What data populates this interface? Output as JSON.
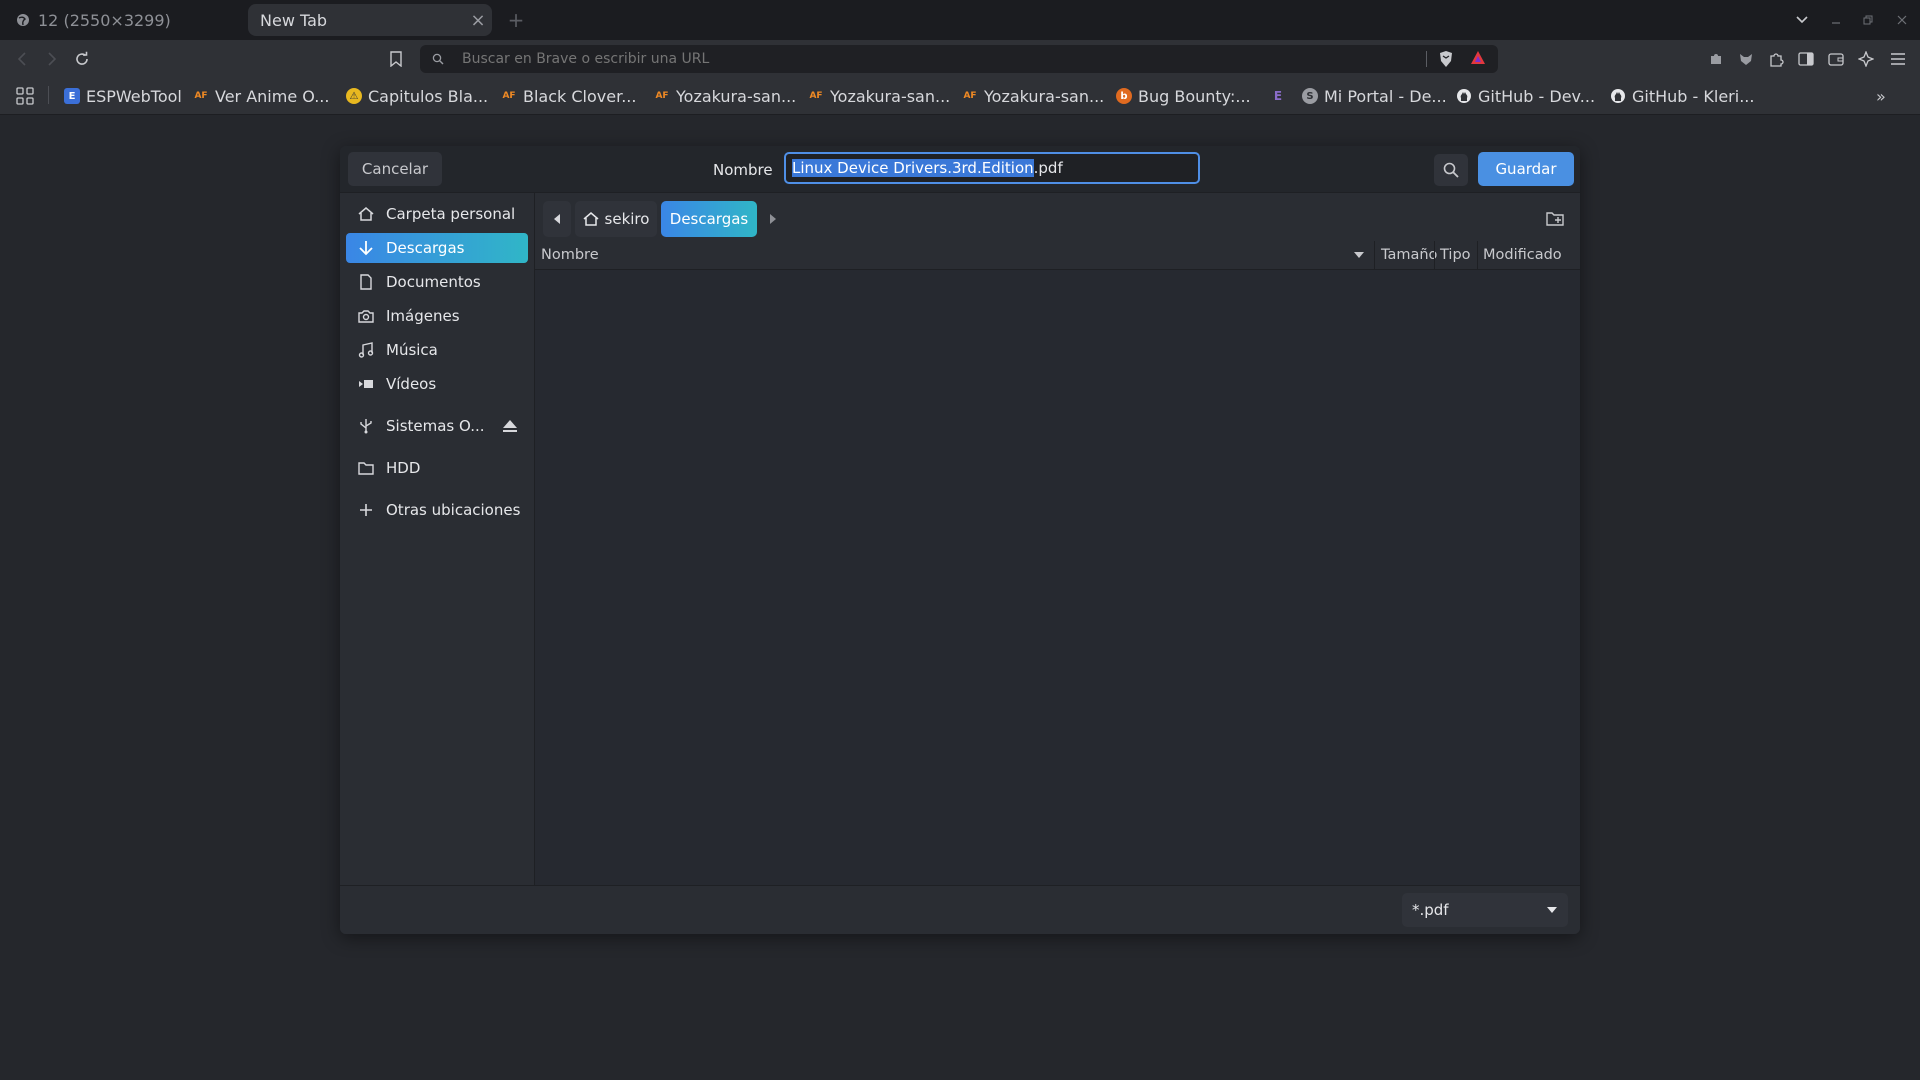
{
  "browser": {
    "tabs": [
      {
        "title": "12 (2550×3299)",
        "icon": "globe-icon",
        "active": false
      },
      {
        "title": "New Tab",
        "close": "×",
        "active": true
      }
    ],
    "new_tab": "+",
    "url_placeholder": "Buscar en Brave o escribir una URL",
    "bookmarks_overflow": "»",
    "bookmarks": [
      {
        "label": "ESPWebTool",
        "icon": "E",
        "color": "#3b6fd8"
      },
      {
        "label": "Ver Anime O...",
        "icon": "AF",
        "color": "#f08a24"
      },
      {
        "label": "Capitulos Bla...",
        "icon": "⚠",
        "color": "#e8b820"
      },
      {
        "label": "Black Clover...",
        "icon": "AF",
        "color": "#f08a24"
      },
      {
        "label": "Yozakura-san...",
        "icon": "AF",
        "color": "#f08a24"
      },
      {
        "label": "Yozakura-san...",
        "icon": "AF",
        "color": "#f08a24"
      },
      {
        "label": "Yozakura-san...",
        "icon": "AF",
        "color": "#f08a24"
      },
      {
        "label": "Bug Bounty:...",
        "icon": "b",
        "color": "#e06a20"
      },
      {
        "label": "",
        "icon": "E",
        "color": "#8a6cc9"
      },
      {
        "label": "Mi Portal - De...",
        "icon": "S",
        "color": "#9a9ca2"
      },
      {
        "label": "GitHub - Dev...",
        "icon": "github",
        "color": "#e6e7ea"
      },
      {
        "label": "GitHub - Kleri...",
        "icon": "github",
        "color": "#e6e7ea"
      }
    ]
  },
  "dialog": {
    "cancel_label": "Cancelar",
    "name_label": "Nombre",
    "filename_selected": "Linux Device Drivers.3rd.Edition",
    "filename_ext": ".pdf",
    "save_label": "Guardar",
    "sidebar": [
      {
        "label": "Carpeta personal",
        "icon": "home-icon"
      },
      {
        "label": "Descargas",
        "icon": "download-icon",
        "active": true
      },
      {
        "label": "Documentos",
        "icon": "document-icon"
      },
      {
        "label": "Imágenes",
        "icon": "camera-icon"
      },
      {
        "label": "Música",
        "icon": "music-icon"
      },
      {
        "label": "Vídeos",
        "icon": "video-icon"
      },
      {
        "label": "Sistemas O...",
        "icon": "usb-icon",
        "eject": true
      },
      {
        "label": "HDD",
        "icon": "folder-icon"
      },
      {
        "label": "Otras ubicaciones",
        "icon": "plus-icon"
      }
    ],
    "path": {
      "home": "sekiro",
      "current": "Descargas"
    },
    "columns": {
      "name": "Nombre",
      "size": "Tamaño",
      "type": "Tipo",
      "modified": "Modificado"
    },
    "filter": "*.pdf"
  },
  "colors": {
    "accent": "#4a90e2",
    "accent_gradient_end": "#30b6c7",
    "background": "#25272c"
  }
}
